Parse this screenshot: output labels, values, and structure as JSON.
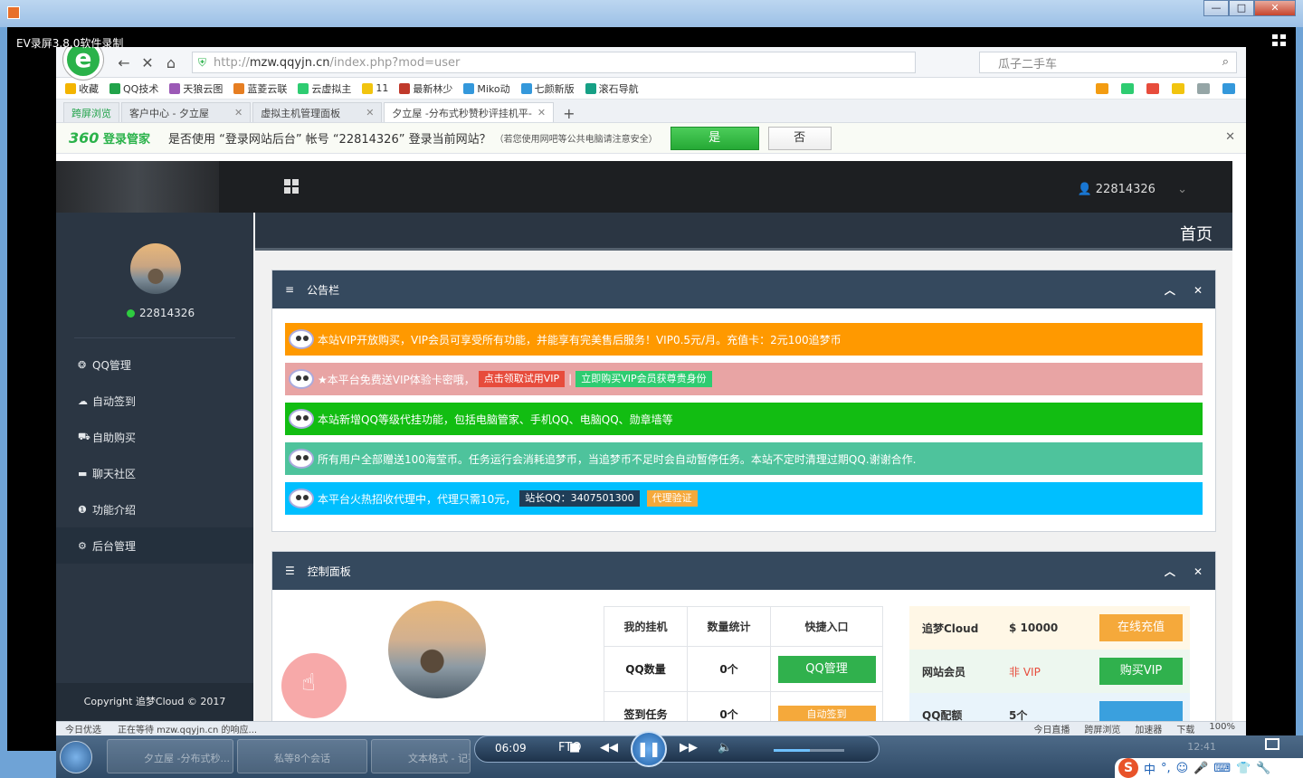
{
  "recorder": {
    "label": "EV录屏3.8.0软件录制"
  },
  "os": {
    "min": "—",
    "max": "□",
    "close": "✕"
  },
  "browser": {
    "url_prefix": "http://",
    "url_host": "mzw.qqyjn.cn",
    "url_path": "/index.php?mod=user",
    "search_placeholder": "瓜子二手车",
    "bookmarks": [
      {
        "label": "收藏",
        "color": "#f3b400"
      },
      {
        "label": "QQ技术",
        "color": "#21a34a"
      },
      {
        "label": "天狼云图",
        "color": "#9b59b6"
      },
      {
        "label": "蓝菱云联",
        "color": "#e67e22"
      },
      {
        "label": "云虚拟主",
        "color": "#2ecc71"
      },
      {
        "label": "11",
        "color": "#f1c40f"
      },
      {
        "label": "最新林少",
        "color": "#c0392b"
      },
      {
        "label": "Miko动",
        "color": "#3498db"
      },
      {
        "label": "七颜新版",
        "color": "#3498db"
      },
      {
        "label": "滚石导航",
        "color": "#16a085"
      }
    ],
    "tabs": [
      {
        "label": "跨屏浏览",
        "close": ""
      },
      {
        "label": "客户中心 - 夕立屋",
        "close": "✕"
      },
      {
        "label": "虚拟主机管理面板",
        "close": "✕"
      },
      {
        "label": "夕立屋 -分布式秒赞秒评挂机平-",
        "close": "✕"
      }
    ],
    "new_tab": "+",
    "login_prompt": {
      "brand_num": "360",
      "brand": "登录管家",
      "text": "是否使用 “登录网站后台” 帐号 “22814326” 登录当前网站？",
      "note": "（若您使用网吧等公共电脑请注意安全）",
      "yes": "是",
      "no": "否",
      "close": "✕"
    }
  },
  "site": {
    "top_user": "22814326",
    "sidebar_user": "22814326",
    "breadcrumb": "首页",
    "menu": [
      {
        "icon": "❂",
        "label": "QQ管理"
      },
      {
        "icon": "☁",
        "label": "自动签到"
      },
      {
        "icon": "⛟",
        "label": "自助购买"
      },
      {
        "icon": "▬",
        "label": "聊天社区"
      },
      {
        "icon": "❶",
        "label": "功能介绍"
      },
      {
        "icon": "⚙",
        "label": "后台管理"
      }
    ],
    "copyright": "Copyright 追梦Cloud © 2017",
    "notice_panel": {
      "title": "公告栏",
      "items": [
        {
          "color": "#ff9900",
          "text": "本站VIP开放购买，VIP会员可享受所有功能，并能享有完美售后服务！VIP0.5元/月。充值卡：2元100追梦币"
        },
        {
          "color": "#e8a4a4",
          "text": "★本平台免费送VIP体验卡密哦，",
          "tag1": "点击领取试用VIP",
          "sep": "|",
          "tag2": "立即购买VIP会员获尊贵身份"
        },
        {
          "color": "#12bd12",
          "text": "本站新增QQ等级代挂功能，包括电脑管家、手机QQ、电脑QQ、勋章墙等"
        },
        {
          "color": "#4ec39c",
          "text": "所有用户全部赠送100海莹币。任务运行会消耗追梦币，当追梦币不足时会自动暂停任务。本站不定时清理过期QQ.谢谢合作."
        },
        {
          "color": "#00bfff",
          "text": "本平台火热招收代理中，代理只需10元，",
          "tag1": "站长QQ：3407501300",
          "tag2": "代理验证"
        }
      ]
    },
    "control_panel": {
      "title": "控制面板",
      "table_headers": [
        "我的挂机",
        "数量统计",
        "快捷入口"
      ],
      "rows": [
        {
          "name": "QQ数量",
          "count": "0个",
          "action": "QQ管理"
        },
        {
          "name": "签到任务",
          "count": "0个",
          "action": "自动签到"
        }
      ],
      "account": [
        {
          "key": "追梦Cloud",
          "value": "$ 10000",
          "button": "在线充值",
          "bg": "#fff7e6",
          "btn_color": "#f5a93b"
        },
        {
          "key": "网站会员",
          "value": "非 VIP",
          "button": "购买VIP",
          "bg": "#edf7ef",
          "btn_color": "#30b14d"
        },
        {
          "key": "QQ配额",
          "value": "5个",
          "button": "",
          "bg": "#e9f4fb",
          "btn_color": "#3aa0de"
        }
      ]
    }
  },
  "status": {
    "left1": "今日优选",
    "left2": "正在等待 mzw.qqyjn.cn 的响应...",
    "items": [
      "今日直播",
      "跨屏浏览",
      "加速器",
      "下载",
      "100%"
    ]
  },
  "player": {
    "time": "06:09",
    "mode": "FTO",
    "clock": "12:41",
    "task1": "夕立屋 -分布式秒...",
    "task2": "私等8个会话",
    "task3": "文本格式 - 记事本"
  },
  "ime": {
    "logo": "S",
    "lang": "中"
  }
}
